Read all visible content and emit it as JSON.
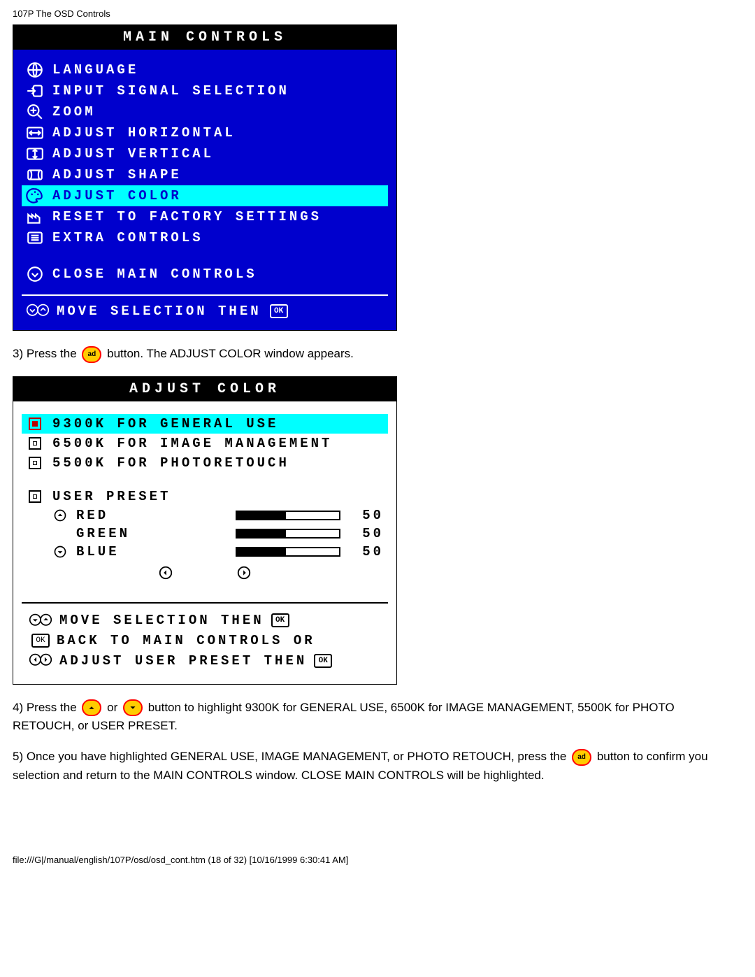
{
  "page_header": "107P The OSD Controls",
  "main_controls": {
    "title": "MAIN CONTROLS",
    "items": [
      {
        "label": "LANGUAGE"
      },
      {
        "label": "INPUT SIGNAL SELECTION"
      },
      {
        "label": "ZOOM"
      },
      {
        "label": "ADJUST HORIZONTAL"
      },
      {
        "label": "ADJUST VERTICAL"
      },
      {
        "label": "ADJUST SHAPE"
      },
      {
        "label": "ADJUST COLOR",
        "selected": true
      },
      {
        "label": "RESET TO FACTORY SETTINGS"
      },
      {
        "label": "EXTRA CONTROLS"
      }
    ],
    "close_label": "CLOSE MAIN CONTROLS",
    "footer_label": "MOVE SELECTION THEN",
    "footer_ok": "OK"
  },
  "step3": {
    "prefix": "3) Press the ",
    "suffix": " button. The ADJUST COLOR window appears."
  },
  "adjust_color": {
    "title": "ADJUST COLOR",
    "options": [
      {
        "label": "9300K FOR GENERAL USE",
        "selected": true
      },
      {
        "label": "6500K FOR IMAGE MANAGEMENT"
      },
      {
        "label": "5500K FOR PHOTORETOUCH"
      }
    ],
    "user_preset_label": "USER PRESET",
    "channels": [
      {
        "name": "RED",
        "value": "50"
      },
      {
        "name": "GREEN",
        "value": "50"
      },
      {
        "name": "BLUE",
        "value": "50"
      }
    ],
    "footer1": "MOVE SELECTION THEN",
    "footer2": "BACK TO MAIN CONTROLS OR",
    "footer3": "ADJUST USER PRESET THEN",
    "ok": "OK"
  },
  "step4": {
    "prefix": "4) Press the ",
    "mid": " or ",
    "suffix": " button to highlight 9300K for GENERAL USE, 6500K for IMAGE MANAGEMENT, 5500K for PHOTO RETOUCH, or USER PRESET."
  },
  "step5": {
    "line1": "5) Once you have highlighted GENERAL USE, IMAGE MANAGEMENT, or PHOTO RETOUCH, press the ",
    "line2": " button to confirm you selection and return to the MAIN CONTROLS window. CLOSE MAIN CONTROLS will be highlighted."
  },
  "page_footer": "file:///G|/manual/english/107P/osd/osd_cont.htm (18 of 32) [10/16/1999 6:30:41 AM]"
}
